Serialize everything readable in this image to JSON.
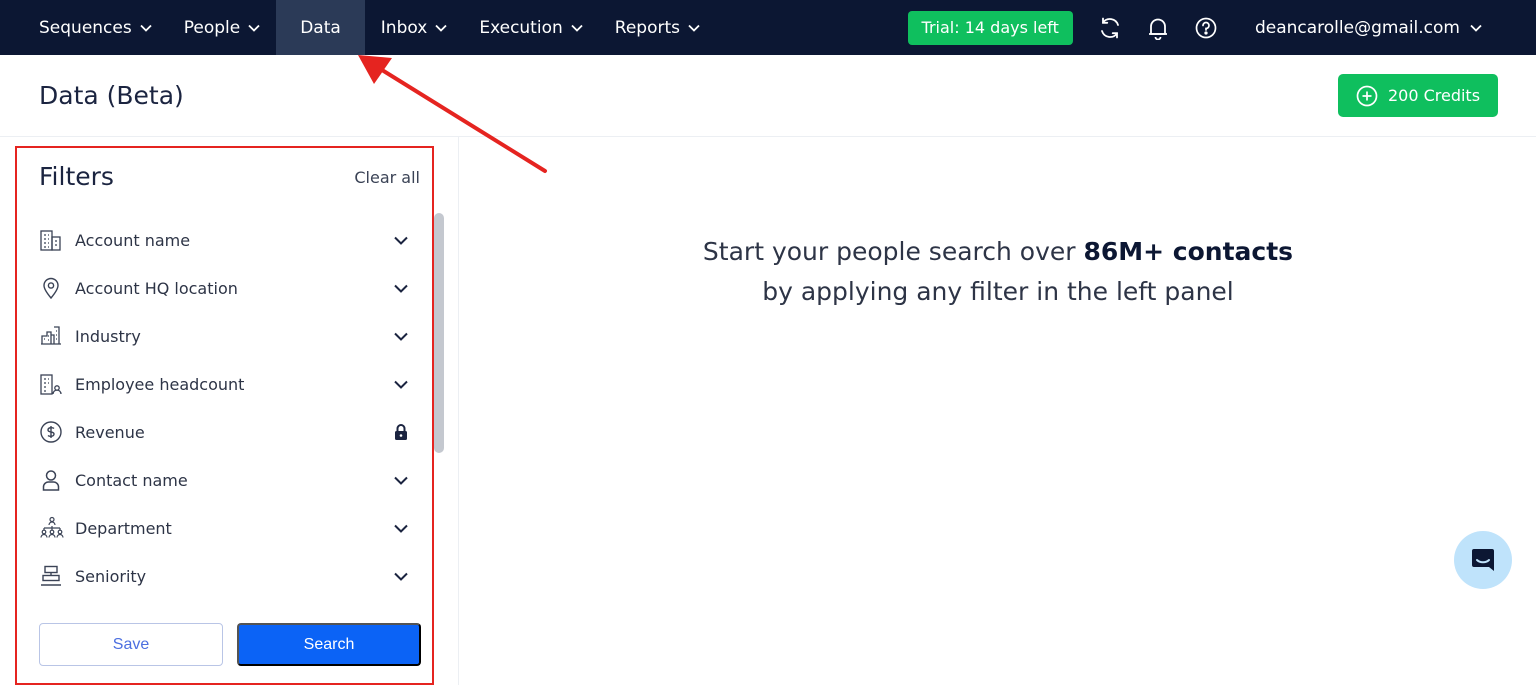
{
  "nav": {
    "items": [
      {
        "label": "Sequences",
        "has_dropdown": true
      },
      {
        "label": "People",
        "has_dropdown": true
      },
      {
        "label": "Data",
        "has_dropdown": false,
        "active": true
      },
      {
        "label": "Inbox",
        "has_dropdown": true
      },
      {
        "label": "Execution",
        "has_dropdown": true
      },
      {
        "label": "Reports",
        "has_dropdown": true
      }
    ],
    "trial_badge": "Trial: 14 days left",
    "icons": [
      "refresh-icon",
      "bell-icon",
      "help-icon"
    ],
    "user_email": "deancarolle@gmail.com"
  },
  "header": {
    "title": "Data (Beta)",
    "credits_label": "200 Credits"
  },
  "filters": {
    "title": "Filters",
    "clear_all": "Clear all",
    "items": [
      {
        "label": "Account name",
        "icon": "building-icon",
        "right": "chevron"
      },
      {
        "label": "Account HQ location",
        "icon": "location-pin-icon",
        "right": "chevron"
      },
      {
        "label": "Industry",
        "icon": "factory-icon",
        "right": "chevron"
      },
      {
        "label": "Employee headcount",
        "icon": "building-people-icon",
        "right": "chevron"
      },
      {
        "label": "Revenue",
        "icon": "dollar-circle-icon",
        "right": "lock"
      },
      {
        "label": "Contact name",
        "icon": "person-icon",
        "right": "chevron"
      },
      {
        "label": "Department",
        "icon": "org-chart-icon",
        "right": "chevron"
      },
      {
        "label": "Seniority",
        "icon": "seniority-icon",
        "right": "chevron"
      }
    ],
    "save_label": "Save",
    "search_label": "Search"
  },
  "main": {
    "message_prefix": "Start your people search over ",
    "message_bold": "86M+ contacts",
    "message_line2": "by applying any filter in the left panel"
  },
  "colors": {
    "nav_bg": "#0c1733",
    "accent_green": "#0fbf5e",
    "primary_blue": "#0b63f6",
    "annotation_red": "#e52420"
  }
}
